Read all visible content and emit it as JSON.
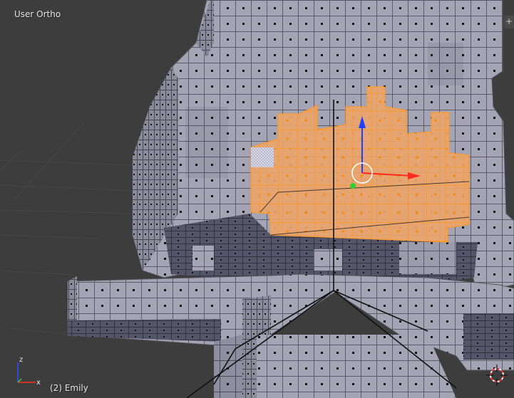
{
  "viewport": {
    "view_label": "User Ortho",
    "object_label": "(2) Emily",
    "background": "#3d3d3d",
    "mesh_color": "#a3a3b4",
    "selection_color": "#f0a050",
    "selection_edge_color": "#ff9a2a"
  },
  "axes_gizmo": {
    "z_label": "z",
    "x_label": "x",
    "z_color": "#3050ff",
    "x_color": "#ff3020",
    "y_color": "#30d030"
  },
  "corner_widget": {
    "glyph": "+"
  }
}
